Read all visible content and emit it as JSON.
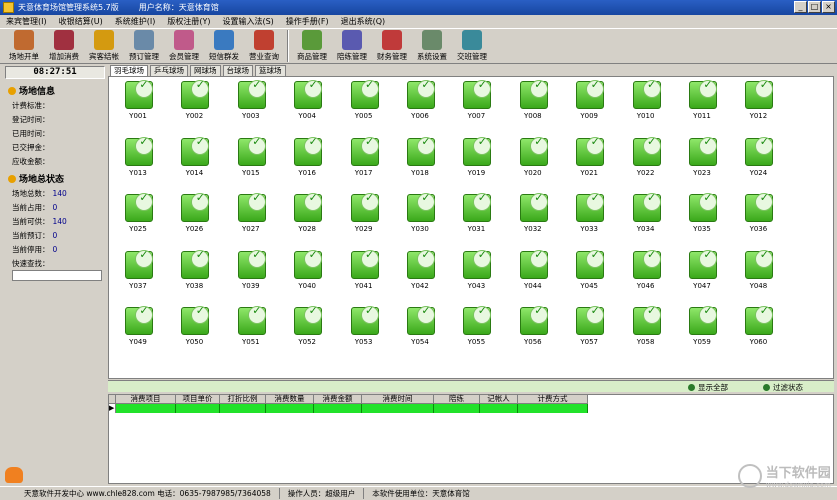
{
  "window": {
    "title": "天意体育场馆管理系统5.7版",
    "user_label": "用户名称：天意体育馆",
    "minimize": "_",
    "maximize": "□",
    "close": "×"
  },
  "menu": [
    "来宾管理(I)",
    "收银结算(U)",
    "系统维护(I)",
    "版权注册(Y)",
    "设置输入法(S)",
    "操作手册(F)",
    "退出系统(Q)"
  ],
  "toolbar": {
    "group1": [
      {
        "label": "场地开单",
        "icon": "open-order-icon",
        "color": "#c06a30"
      },
      {
        "label": "增加消费",
        "icon": "add-consumption-icon",
        "color": "#a03040"
      },
      {
        "label": "宾客结帐",
        "icon": "checkout-coins-icon",
        "color": "#d49a10"
      },
      {
        "label": "预订管理",
        "icon": "clock-icon",
        "color": "#6a8aa8"
      },
      {
        "label": "会员管理",
        "icon": "member-card-icon",
        "color": "#c05a8a"
      },
      {
        "label": "短信群发",
        "icon": "globe-sms-icon",
        "color": "#3a7ac0"
      },
      {
        "label": "营业查询",
        "icon": "house-query-icon",
        "color": "#c04030"
      }
    ],
    "group2": [
      {
        "label": "商品管理",
        "icon": "goods-icon",
        "color": "#5a9a3a"
      },
      {
        "label": "陪练管理",
        "icon": "coach-book-icon",
        "color": "#5a5ab0"
      },
      {
        "label": "财务管理",
        "icon": "finance-icon",
        "color": "#c03a3a"
      },
      {
        "label": "系统设置",
        "icon": "settings-icon",
        "color": "#6a8a6a"
      },
      {
        "label": "交班管理",
        "icon": "handover-icon",
        "color": "#3a8a9a"
      }
    ]
  },
  "clock": "08:27:51",
  "site_info": {
    "title": "场地信息",
    "fields": [
      "计费标准：",
      "登记时间：",
      "已用时间：",
      "已交押金：",
      "应收金额："
    ]
  },
  "site_status": {
    "title": "场地总状态",
    "fields": [
      {
        "label": "场地总数：",
        "value": "140"
      },
      {
        "label": "当前占用：",
        "value": "0"
      },
      {
        "label": "当前可供：",
        "value": "140"
      },
      {
        "label": "当前预订：",
        "value": "0"
      },
      {
        "label": "当前停用：",
        "value": "0"
      }
    ],
    "search_label": "快速查找："
  },
  "tabs": [
    "羽毛球场",
    "乒乓球场",
    "网球场",
    "台球场",
    "篮球场"
  ],
  "courts": [
    "Y001",
    "Y002",
    "Y003",
    "Y004",
    "Y005",
    "Y006",
    "Y007",
    "Y008",
    "Y009",
    "Y010",
    "Y011",
    "Y012",
    "Y013",
    "Y014",
    "Y015",
    "Y016",
    "Y017",
    "Y018",
    "Y019",
    "Y020",
    "Y021",
    "Y022",
    "Y023",
    "Y024",
    "Y025",
    "Y026",
    "Y027",
    "Y028",
    "Y029",
    "Y030",
    "Y031",
    "Y032",
    "Y033",
    "Y034",
    "Y035",
    "Y036",
    "Y037",
    "Y038",
    "Y039",
    "Y040",
    "Y041",
    "Y042",
    "Y043",
    "Y044",
    "Y045",
    "Y046",
    "Y047",
    "Y048",
    "Y049",
    "Y050",
    "Y051",
    "Y052",
    "Y053",
    "Y054",
    "Y055",
    "Y056",
    "Y057",
    "Y058",
    "Y059",
    "Y060"
  ],
  "actions": {
    "show_all": "显示全部",
    "filter_status": "过滤状态"
  },
  "table": {
    "columns": [
      "消费项目",
      "项目单价",
      "打折比例",
      "消费数量",
      "消费金额",
      "消费时间",
      "陪练",
      "记帐人",
      "计费方式"
    ]
  },
  "statusbar": {
    "developer": "天意软件开发中心 www.chle828.com 电话：0635-7987985/7364058",
    "operator": "操作人员：超级用户",
    "licensee": "本软件使用单位：天意体育馆"
  },
  "watermark": {
    "text": "当下软件园",
    "url": "www.downxia.com"
  }
}
